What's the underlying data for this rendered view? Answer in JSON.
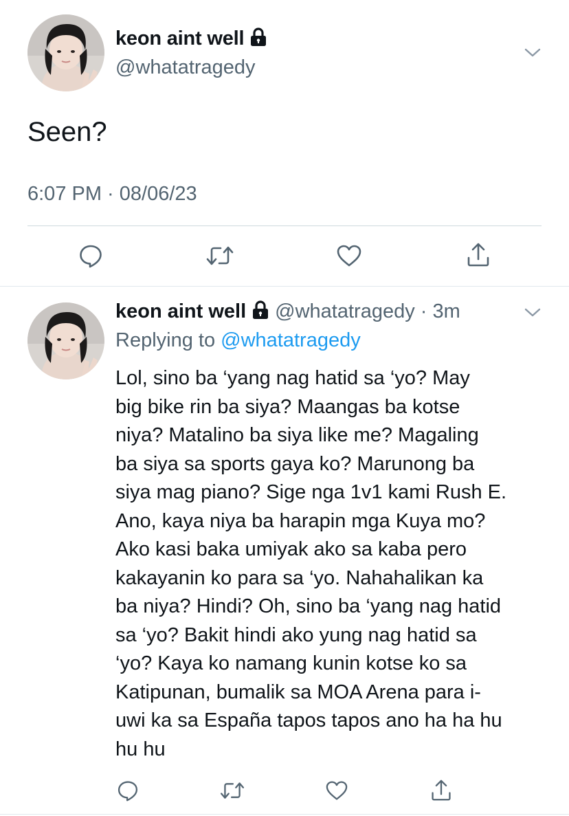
{
  "main_tweet": {
    "display_name": "keon aint well",
    "handle": "@whatatragedy",
    "text": "Seen?",
    "timestamp": "6:07 PM · 08/06/23"
  },
  "reply_tweet": {
    "display_name": "keon aint well",
    "handle_time": "@whatatragedy · 3m",
    "replying_prefix": "Replying to",
    "replying_to": "@whatatragedy",
    "lines": [
      "Lol, sino ba ‘yang nag hatid sa ‘yo? May",
      "big bike rin ba siya? Maangas ba kotse",
      "niya? Matalino ba siya like me? Magaling",
      "ba siya sa sports gaya ko? Marunong ba",
      "siya mag piano? Sige nga 1v1 kami Rush E.",
      "Ano, kaya niya ba harapin mga Kuya mo?",
      "Ako kasi baka umiyak ako sa kaba pero",
      "kakayanin ko para sa ‘yo. Nahahalikan ka",
      "ba niya? Hindi? Oh, sino ba ‘yang nag hatid",
      "sa ‘yo? Bakit hindi ako yung nag hatid sa",
      "‘yo? Kaya ko namang kunin kotse ko sa",
      "Katipunan, bumalik sa MOA Arena para i-",
      "uwi ka sa España tapos tapos ano ha ha hu",
      "hu hu"
    ]
  },
  "icons": {
    "reply": "reply-icon",
    "retweet": "retweet-icon",
    "like": "heart-icon",
    "share": "share-icon",
    "lock": "lock-icon",
    "more": "chevron-down-icon"
  },
  "colors": {
    "text": "#0f1419",
    "secondary": "#536471",
    "link": "#1d9bf0",
    "divider": "#cfd9de"
  }
}
